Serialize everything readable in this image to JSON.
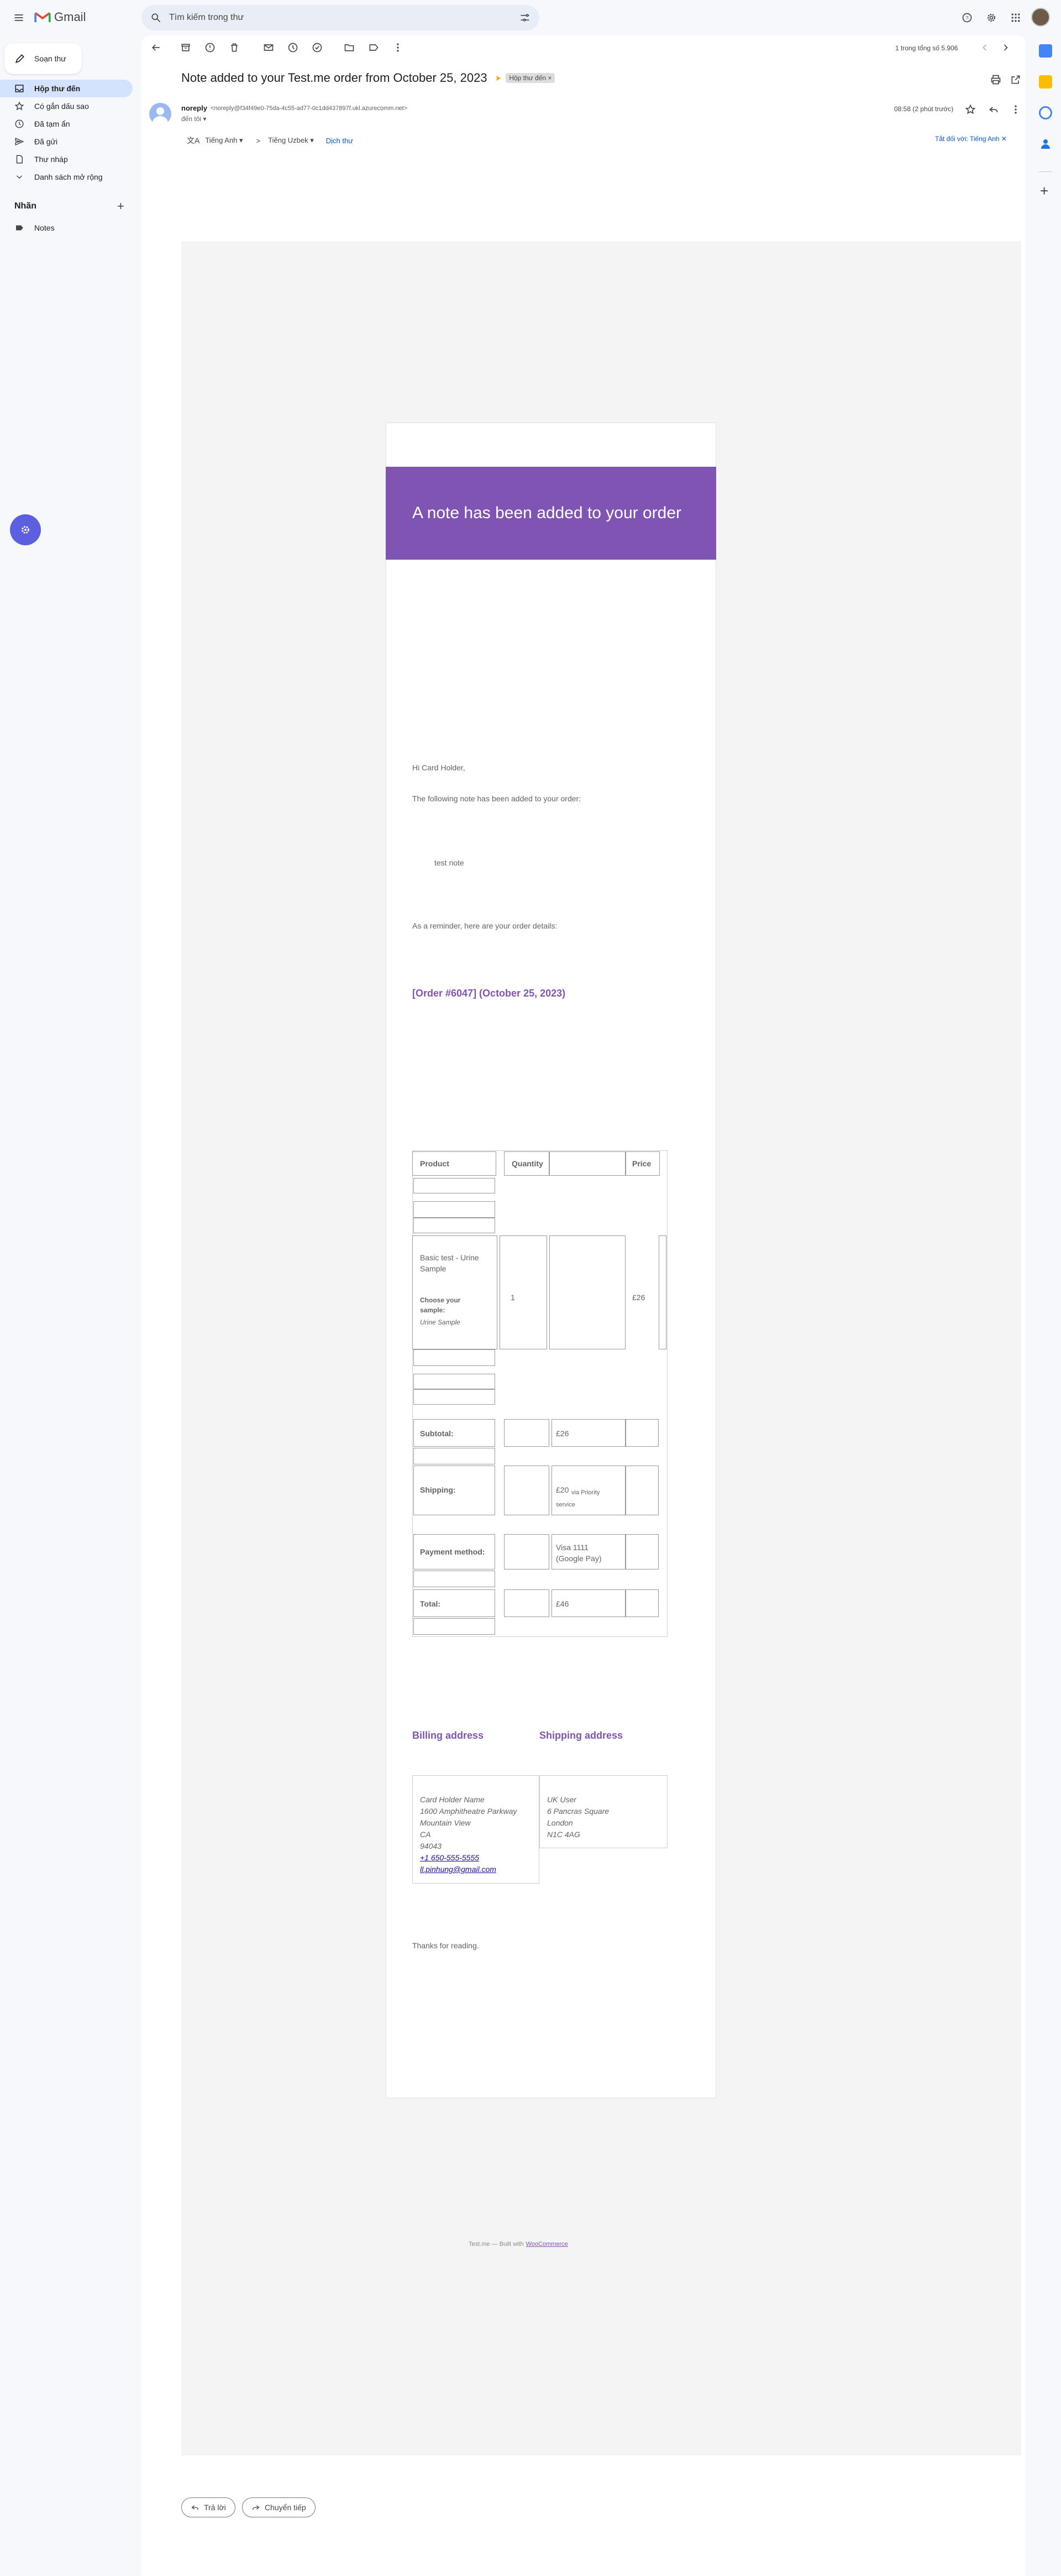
{
  "app": {
    "name": "Gmail"
  },
  "search": {
    "placeholder": "Tìm kiếm trong thư"
  },
  "sidebar": {
    "compose_label": "Soạn thư",
    "items": [
      {
        "label": "Hộp thư đến",
        "icon": "inbox-icon"
      },
      {
        "label": "Có gắn dấu sao",
        "icon": "star-icon"
      },
      {
        "label": "Đã tạm ẩn",
        "icon": "clock-icon"
      },
      {
        "label": "Đã gửi",
        "icon": "send-icon"
      },
      {
        "label": "Thư nháp",
        "icon": "draft-icon"
      },
      {
        "label": "Danh sách mở rộng",
        "icon": "chevron-down-icon"
      }
    ],
    "labels_heading": "Nhãn",
    "labels": [
      {
        "label": "Notes",
        "icon": "label-icon"
      }
    ]
  },
  "toolbar": {
    "pagination": "1 trong tổng số 5.906"
  },
  "email": {
    "subject": "Note added to your Test.me order from October 25, 2023",
    "inbox_badge": "Hộp thư đến ×",
    "sender_name": "noreply",
    "sender_email": "<noreply@f34f49e0-75da-4c55-ad77-0c1dd437897f.ukl.azurecomm.net>",
    "to_me": "đến tôi ▾",
    "time": "08:58 (2 phút trước)",
    "translate": {
      "from": "Tiếng Anh ▾",
      "to": "Tiếng Uzbek ▾",
      "action": "Dịch thư",
      "turn_off": "Tắt đối với: Tiếng Anh ✕"
    }
  },
  "body": {
    "banner": "A note has been added to your order",
    "greeting": "Hi Card Holder,",
    "intro": "The following note has been added to your order:",
    "note": "test note",
    "reminder": "As a reminder, here are your order details:",
    "order_heading": "[Order #6047] (October 25, 2023)",
    "table": {
      "col_product": "Product",
      "col_quantity": "Quantity",
      "col_price": "Price",
      "item_name": "Basic test - Urine Sample",
      "item_meta_key": "Choose your sample:",
      "item_meta_value": "Urine Sample",
      "item_qty": "1",
      "item_price": "£26",
      "subtotal_label": "Subtotal:",
      "subtotal_value": "£26",
      "shipping_label": "Shipping:",
      "shipping_value": "£20",
      "shipping_via": "via Priority service",
      "payment_label": "Payment method:",
      "payment_value": "Visa 1111 (Google Pay)",
      "total_label": "Total:",
      "total_value": "£46"
    },
    "billing_heading": "Billing address",
    "shipping_heading": "Shipping address",
    "billing_lines": [
      "Card Holder Name",
      "1600 Amphitheatre Parkway",
      "Mountain View",
      "CA",
      "94043"
    ],
    "billing_phone": "+1 650-555-5555",
    "billing_email": "ll.pinhung@gmail.com",
    "shipping_lines": [
      "UK User",
      "6 Pancras Square",
      "London",
      "N1C 4AG"
    ],
    "thanks": "Thanks for reading.",
    "footer_prefix": "Test.me — Built with",
    "footer_link": "WooCommerce"
  },
  "actions": {
    "reply": "Trả lời",
    "forward": "Chuyển tiếp"
  },
  "colors": {
    "accent": "#7f54b3",
    "selected": "#d3e3fd"
  }
}
